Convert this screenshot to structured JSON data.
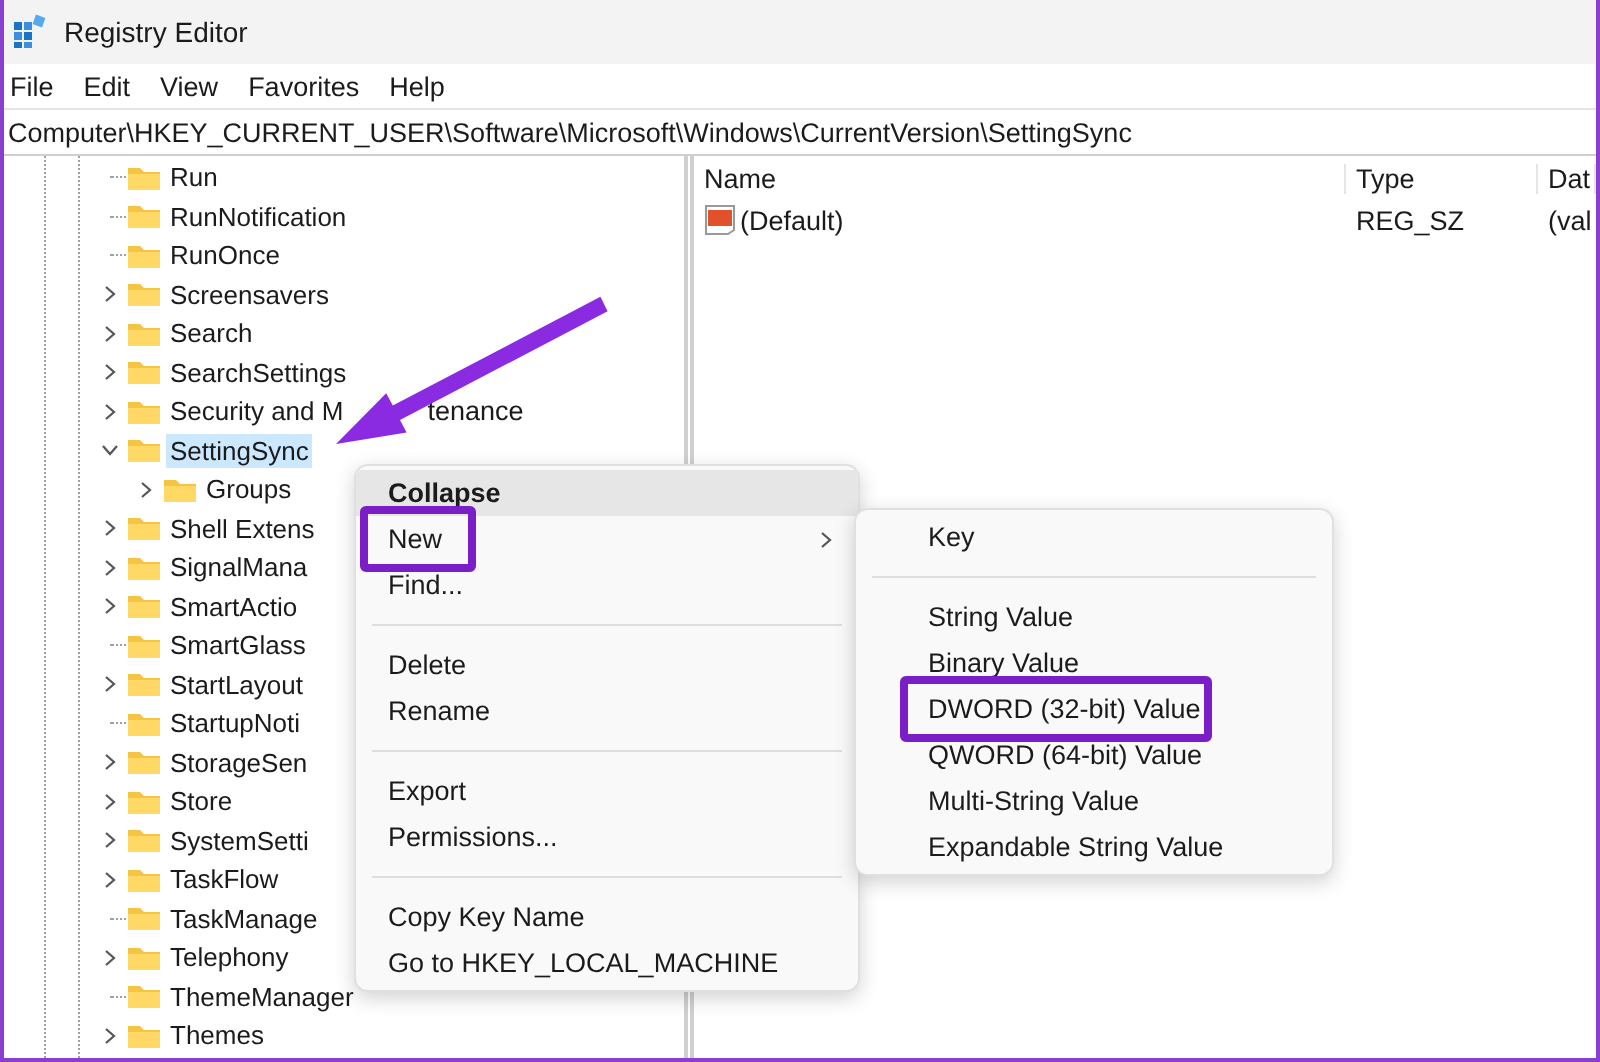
{
  "window": {
    "title": "Registry Editor"
  },
  "menu_bar": [
    "File",
    "Edit",
    "View",
    "Favorites",
    "Help"
  ],
  "address": "Computer\\HKEY_CURRENT_USER\\Software\\Microsoft\\Windows\\CurrentVersion\\SettingSync",
  "tree": [
    {
      "label": "Run",
      "expandable": false,
      "selected": false
    },
    {
      "label": "RunNotification",
      "expandable": false,
      "selected": false
    },
    {
      "label": "RunOnce",
      "expandable": false,
      "selected": false
    },
    {
      "label": "Screensavers",
      "expandable": true,
      "expanded": false,
      "selected": false
    },
    {
      "label": "Search",
      "expandable": true,
      "expanded": false,
      "selected": false
    },
    {
      "label": "SearchSettings",
      "expandable": true,
      "expanded": false,
      "selected": false
    },
    {
      "label": "Security and M",
      "label_tail": "tenance",
      "expandable": true,
      "expanded": false,
      "selected": false
    },
    {
      "label": "SettingSync",
      "expandable": true,
      "expanded": true,
      "selected": true,
      "children": [
        {
          "label": "Groups",
          "expandable": true,
          "expanded": false,
          "selected": false
        }
      ]
    },
    {
      "label": "Shell Extens",
      "expandable": true,
      "expanded": false,
      "selected": false
    },
    {
      "label": "SignalMana",
      "expandable": true,
      "expanded": false,
      "selected": false
    },
    {
      "label": "SmartActio",
      "expandable": true,
      "expanded": false,
      "selected": false
    },
    {
      "label": "SmartGlass",
      "expandable": false,
      "selected": false
    },
    {
      "label": "StartLayout",
      "expandable": true,
      "expanded": false,
      "selected": false
    },
    {
      "label": "StartupNoti",
      "expandable": false,
      "selected": false
    },
    {
      "label": "StorageSen",
      "expandable": true,
      "expanded": false,
      "selected": false
    },
    {
      "label": "Store",
      "expandable": true,
      "expanded": false,
      "selected": false
    },
    {
      "label": "SystemSetti",
      "expandable": true,
      "expanded": false,
      "selected": false
    },
    {
      "label": "TaskFlow",
      "expandable": true,
      "expanded": false,
      "selected": false
    },
    {
      "label": "TaskManage",
      "expandable": false,
      "selected": false
    },
    {
      "label": "Telephony",
      "expandable": true,
      "expanded": false,
      "selected": false
    },
    {
      "label": "ThemeManager",
      "expandable": false,
      "selected": false
    },
    {
      "label": "Themes",
      "expandable": true,
      "expanded": false,
      "selected": false
    }
  ],
  "values": {
    "columns": [
      "Name",
      "Type",
      "Dat"
    ],
    "rows": [
      {
        "name": "(Default)",
        "type": "REG_SZ",
        "data": "(val"
      }
    ]
  },
  "context_menu": {
    "groups": [
      [
        {
          "label": "Collapse",
          "bold": true,
          "hovered": true,
          "highlighted": false,
          "submenu": false
        },
        {
          "label": "New",
          "bold": false,
          "hovered": false,
          "highlighted": true,
          "submenu": true
        },
        {
          "label": "Find...",
          "bold": false,
          "hovered": false,
          "highlighted": false,
          "submenu": false
        }
      ],
      [
        {
          "label": "Delete",
          "bold": false,
          "hovered": false,
          "highlighted": false,
          "submenu": false
        },
        {
          "label": "Rename",
          "bold": false,
          "hovered": false,
          "highlighted": false,
          "submenu": false
        }
      ],
      [
        {
          "label": "Export",
          "bold": false,
          "hovered": false,
          "highlighted": false,
          "submenu": false
        },
        {
          "label": "Permissions...",
          "bold": false,
          "hovered": false,
          "highlighted": false,
          "submenu": false
        }
      ],
      [
        {
          "label": "Copy Key Name",
          "bold": false,
          "hovered": false,
          "highlighted": false,
          "submenu": false
        },
        {
          "label": "Go to HKEY_LOCAL_MACHINE",
          "bold": false,
          "hovered": false,
          "highlighted": false,
          "submenu": false
        }
      ]
    ]
  },
  "submenu": {
    "groups": [
      [
        {
          "label": "Key",
          "highlighted": false
        }
      ],
      [
        {
          "label": "String Value",
          "highlighted": false
        },
        {
          "label": "Binary Value",
          "highlighted": false
        },
        {
          "label": "DWORD (32-bit) Value",
          "highlighted": true
        },
        {
          "label": "QWORD (64-bit) Value",
          "highlighted": false
        },
        {
          "label": "Multi-String Value",
          "highlighted": false
        },
        {
          "label": "Expandable String Value",
          "highlighted": false
        }
      ]
    ]
  }
}
